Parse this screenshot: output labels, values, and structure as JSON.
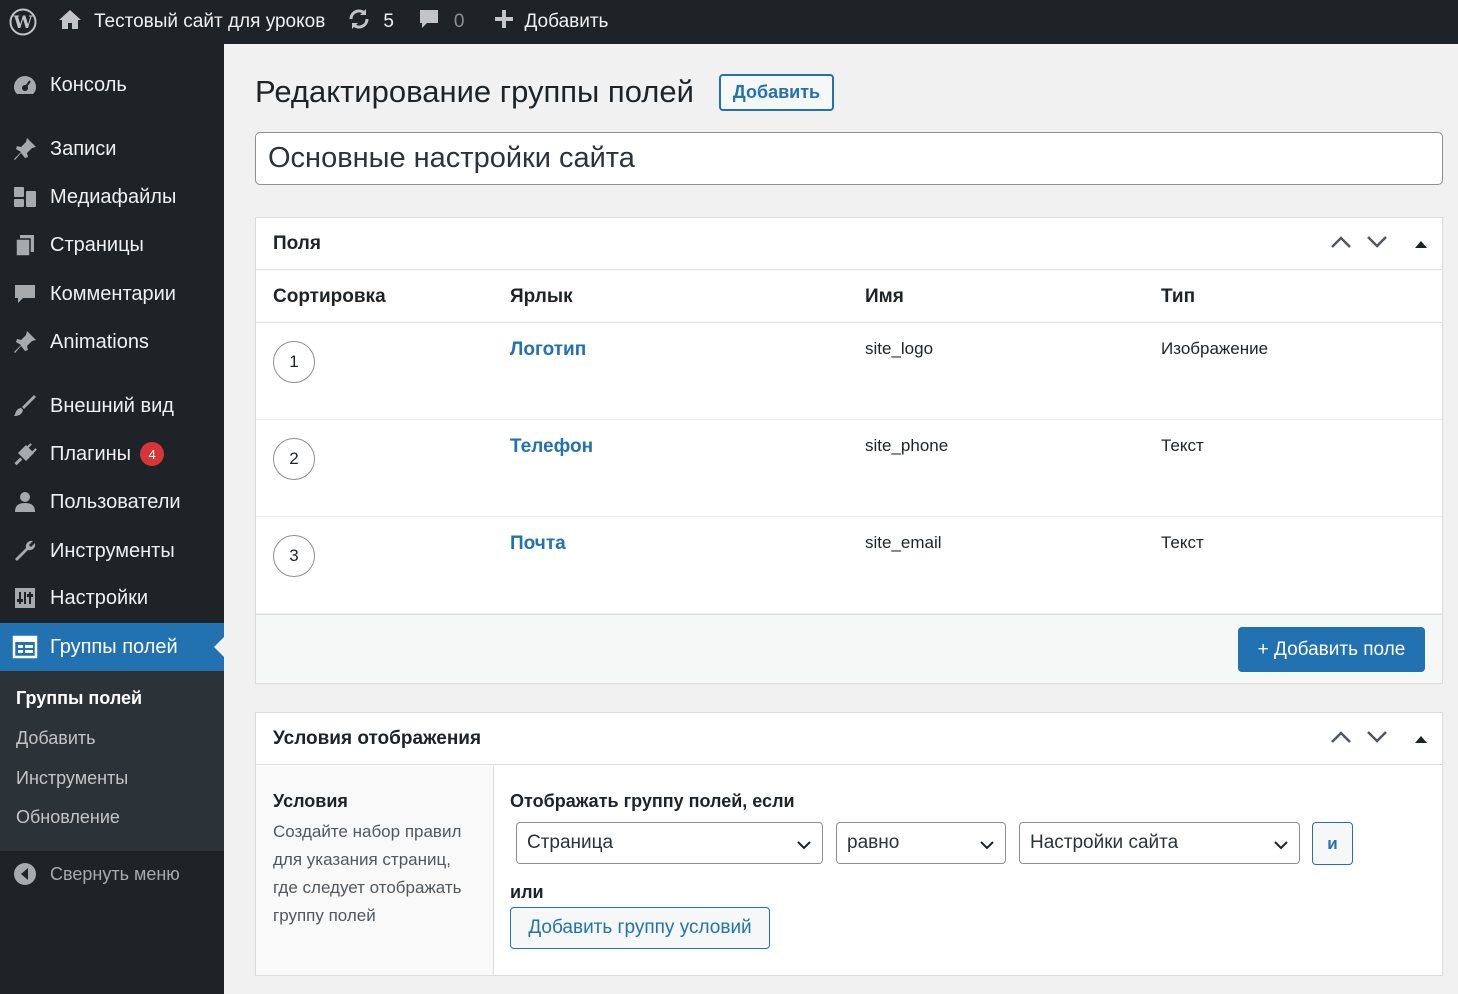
{
  "adminbar": {
    "site_title": "Тестовый сайт для уроков",
    "updates_count": "5",
    "comments_count": "0",
    "new_label": "Добавить"
  },
  "sidebar": {
    "items": [
      {
        "label": "Консоль",
        "icon": "dashboard-icon"
      },
      {
        "label": "Записи",
        "icon": "pin-icon"
      },
      {
        "label": "Медиафайлы",
        "icon": "media-icon"
      },
      {
        "label": "Страницы",
        "icon": "pages-icon"
      },
      {
        "label": "Комментарии",
        "icon": "comment-icon"
      },
      {
        "label": "Animations",
        "icon": "pin-icon"
      },
      {
        "label": "Внешний вид",
        "icon": "brush-icon"
      },
      {
        "label": "Плагины",
        "icon": "plugin-icon",
        "badge": "4"
      },
      {
        "label": "Пользователи",
        "icon": "user-icon"
      },
      {
        "label": "Инструменты",
        "icon": "wrench-icon"
      },
      {
        "label": "Настройки",
        "icon": "settings-icon"
      },
      {
        "label": "Группы полей",
        "icon": "table-icon",
        "current": true
      }
    ],
    "submenu": [
      "Группы полей",
      "Добавить",
      "Инструменты",
      "Обновление"
    ],
    "collapse_label": "Свернуть меню"
  },
  "page": {
    "title": "Редактирование группы полей",
    "add_button": "Добавить",
    "group_title_value": "Основные настройки сайта"
  },
  "fields_box": {
    "title": "Поля",
    "columns": [
      "Сортировка",
      "Ярлык",
      "Имя",
      "Тип"
    ],
    "rows": [
      {
        "order": "1",
        "label": "Логотип",
        "name": "site_logo",
        "type": "Изображение"
      },
      {
        "order": "2",
        "label": "Телефон",
        "name": "site_phone",
        "type": "Текст"
      },
      {
        "order": "3",
        "label": "Почта",
        "name": "site_email",
        "type": "Текст"
      }
    ],
    "add_field_button": "+ Добавить поле"
  },
  "conditions_box": {
    "title": "Условия отображения",
    "left_title": "Условия",
    "left_desc": "Создайте набор правил для указания страниц, где следует отображать группу полей",
    "rule_label": "Отображать группу полей, если",
    "param": "Страница",
    "operator": "равно",
    "value": "Настройки сайта",
    "and_button": "и",
    "or_label": "или",
    "add_group_button": "Добавить группу условий"
  },
  "colors": {
    "accent": "#2271b1",
    "sidebar_bg": "#1d2327",
    "submenu_bg": "#2c3338",
    "badge": "#d63638"
  }
}
